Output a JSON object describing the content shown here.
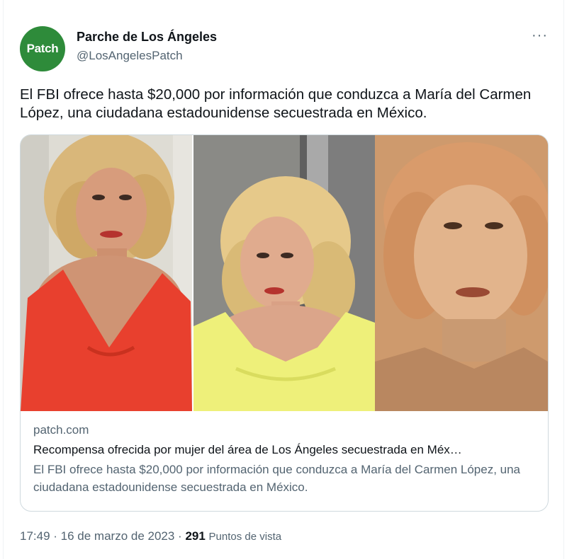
{
  "author": {
    "display_name": "Parche de Los Ángeles",
    "handle": "@LosAngelesPatch",
    "avatar_text": "Patch",
    "avatar_color": "#2e8b3a"
  },
  "more_icon": "more-horizontal-icon",
  "more_glyph": "···",
  "tweet": {
    "text": "El FBI ofrece hasta $20,000 por información que conduzca a María del Carmen López, una ciudadana estadounidense secuestrada en México."
  },
  "card": {
    "domain": "patch.com",
    "title": "Recompensa ofrecida por mujer del área de Los Ángeles secuestrada en Méx…",
    "description": "El FBI ofrece hasta $20,000 por información que conduzca a María del Carmen López, una ciudadana estadounidense secuestrada en México.",
    "photos": [
      {
        "name": "woman-red-top-photo"
      },
      {
        "name": "woman-yellow-top-photo"
      },
      {
        "name": "woman-sepia-portrait-photo"
      }
    ]
  },
  "meta": {
    "time": "17:49",
    "separator": " · ",
    "date": "16 de marzo de 2023",
    "views_count": "291",
    "views_label": "Puntos de vista"
  },
  "colors": {
    "text_primary": "#0f1419",
    "text_secondary": "#536471",
    "border": "#cfd9de"
  }
}
